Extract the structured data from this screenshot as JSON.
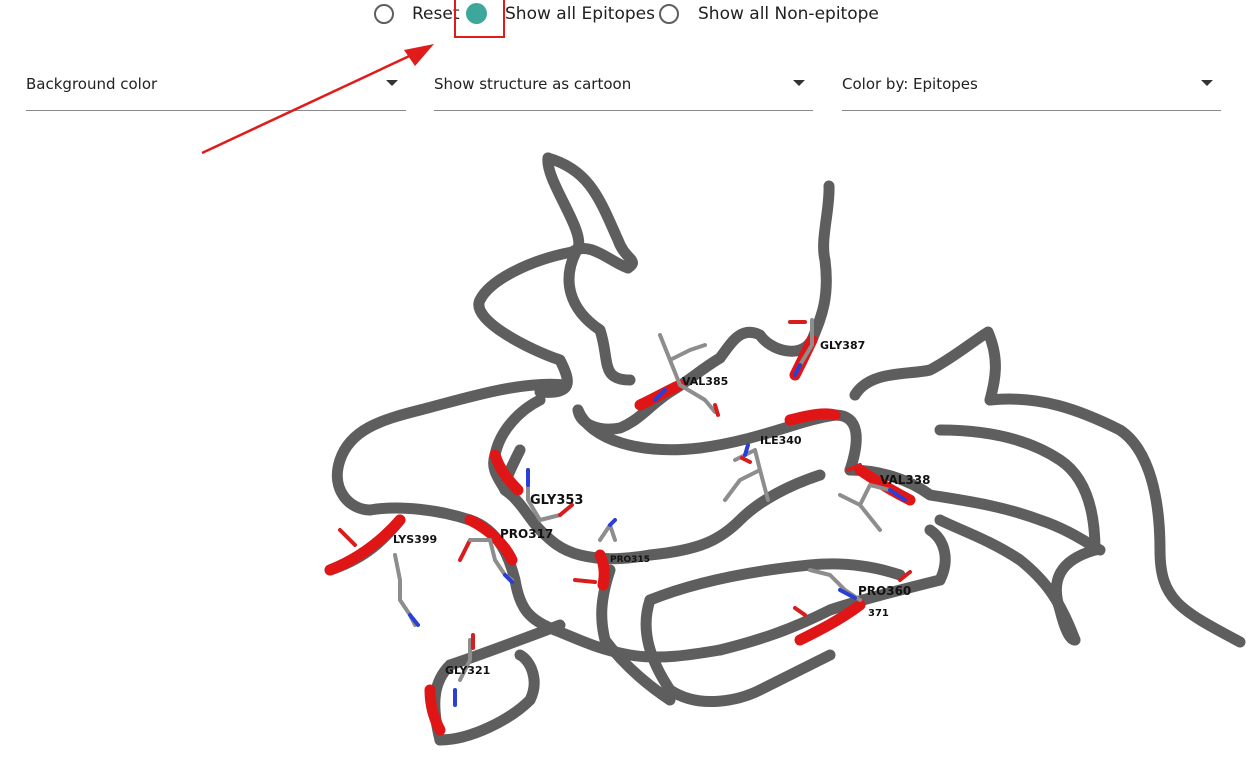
{
  "radio_group": {
    "options": [
      {
        "label": "Reset",
        "checked": false
      },
      {
        "label": "Show all Epitopes",
        "checked": true
      },
      {
        "label": "Show all Non-epitope",
        "checked": false
      }
    ],
    "selected_color": "#3ea79c"
  },
  "controls": {
    "background_color": {
      "value": "Background color"
    },
    "structure_style": {
      "value": "Show structure as cartoon"
    },
    "color_by": {
      "value": "Color by: Epitopes"
    }
  },
  "viewer": {
    "residue_labels": [
      "GLY387",
      "VAL385",
      "ILE340",
      "VAL338",
      "GLY353",
      "PRO317",
      "PRO315",
      "LYS399",
      "PRO360",
      "371",
      "GLY321"
    ],
    "colors": {
      "backbone": "#5e5e5e",
      "epitope": "#e01616",
      "carbon": "#8d8d8d",
      "nitrogen": "#2a3fd6",
      "oxygen": "#d81d1d"
    }
  },
  "annotation": {
    "color": "#e11b1b"
  }
}
